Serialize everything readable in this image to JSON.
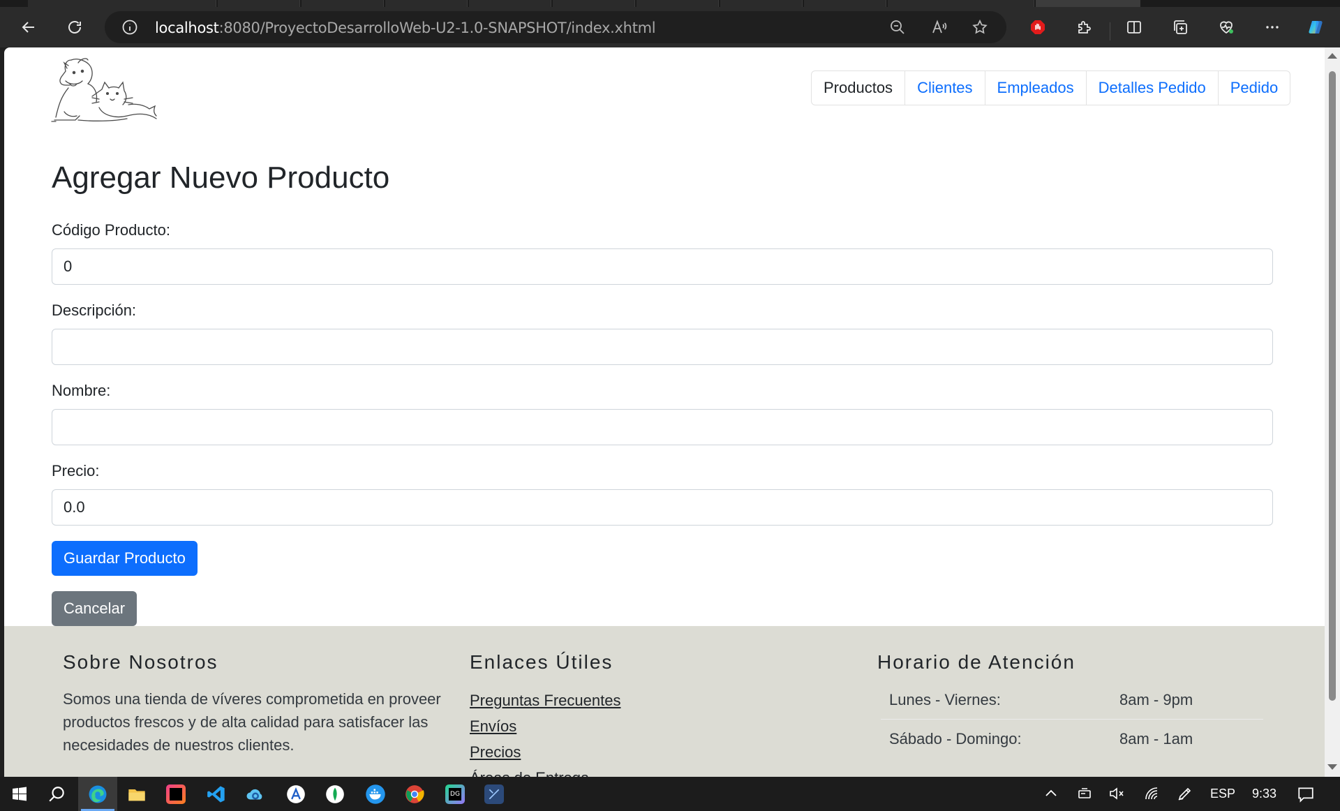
{
  "browser": {
    "url_host": "localhost",
    "url_path": ":8080/ProyectoDesarrolloWeb-U2-1.0-SNAPSHOT/index.xhtml"
  },
  "nav": {
    "items": [
      "Productos",
      "Clientes",
      "Empleados",
      "Detalles Pedido",
      "Pedido"
    ]
  },
  "form": {
    "title": "Agregar Nuevo Producto",
    "fields": [
      {
        "label": "Código Producto:",
        "value": "0"
      },
      {
        "label": "Descripción:",
        "value": ""
      },
      {
        "label": "Nombre:",
        "value": ""
      },
      {
        "label": "Precio:",
        "value": "0.0"
      }
    ],
    "save_label": "Guardar Producto",
    "cancel_label": "Cancelar"
  },
  "footer": {
    "about": {
      "title": "Sobre Nosotros",
      "text": "Somos una tienda de víveres comprometida en proveer productos frescos y de alta calidad para satisfacer las necesidades de nuestros clientes."
    },
    "links": {
      "title": "Enlaces Útiles",
      "items": [
        "Preguntas Frecuentes",
        "Envíos",
        "Precios",
        "Áreas de Entrega"
      ]
    },
    "hours": {
      "title": "Horario de Atención",
      "rows": [
        {
          "day": "Lunes - Viernes:",
          "time": "8am - 9pm"
        },
        {
          "day": "Sábado - Domingo:",
          "time": "8am - 1am"
        }
      ]
    }
  },
  "taskbar": {
    "language": "ESP",
    "clock": "9:33"
  },
  "colors": {
    "primary": "#0d6efd",
    "secondary": "#6c757d",
    "footer_bg": "#dcdcd4",
    "chrome_bg": "#2b2b2b"
  }
}
